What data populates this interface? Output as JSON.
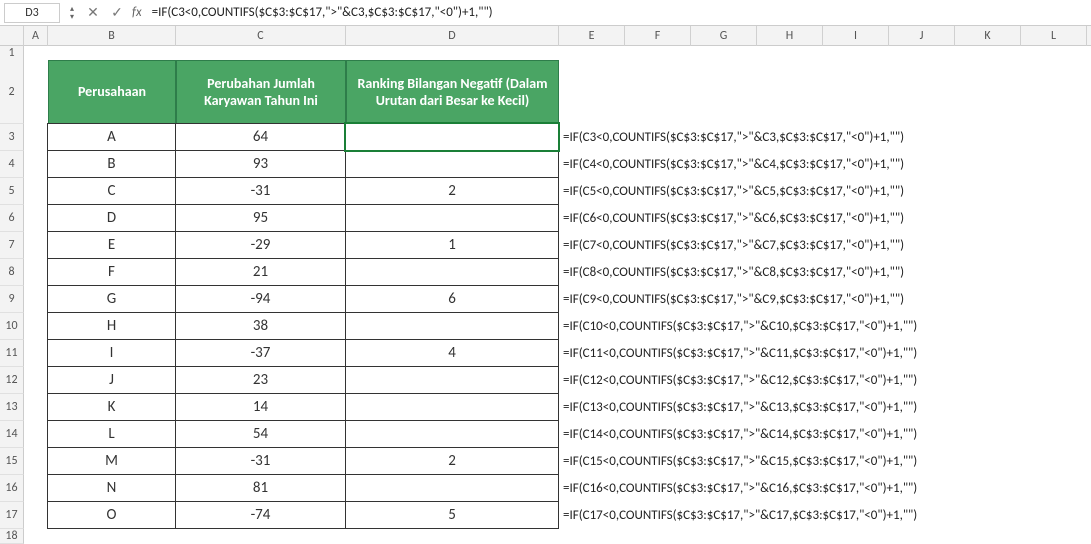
{
  "nameBox": "D3",
  "formulaBar": "=IF(C3<0,COUNTIFS($C$3:$C$17,\">\"&C3,$C$3:$C$17,\"<0\")+1,\"\")",
  "columns": [
    "",
    "A",
    "B",
    "C",
    "D",
    "E",
    "F",
    "G",
    "H",
    "I",
    "J",
    "K",
    "L"
  ],
  "headerLabels": {
    "col1": "Perusahaan",
    "col2": "Perubahan Jumlah Karyawan Tahun Ini",
    "col3": "Ranking Bilangan Negatif (Dalam Urutan dari Besar ke Kecil)"
  },
  "rows": [
    {
      "n": "3",
      "p": "A",
      "v": "64",
      "r": "",
      "f": "=IF(C3<0,COUNTIFS($C$3:$C$17,\">\"&C3,$C$3:$C$17,\"<0\")+1,\"\")"
    },
    {
      "n": "4",
      "p": "B",
      "v": "93",
      "r": "",
      "f": "=IF(C4<0,COUNTIFS($C$3:$C$17,\">\"&C4,$C$3:$C$17,\"<0\")+1,\"\")"
    },
    {
      "n": "5",
      "p": "C",
      "v": "-31",
      "r": "2",
      "f": "=IF(C5<0,COUNTIFS($C$3:$C$17,\">\"&C5,$C$3:$C$17,\"<0\")+1,\"\")"
    },
    {
      "n": "6",
      "p": "D",
      "v": "95",
      "r": "",
      "f": "=IF(C6<0,COUNTIFS($C$3:$C$17,\">\"&C6,$C$3:$C$17,\"<0\")+1,\"\")"
    },
    {
      "n": "7",
      "p": "E",
      "v": "-29",
      "r": "1",
      "f": "=IF(C7<0,COUNTIFS($C$3:$C$17,\">\"&C7,$C$3:$C$17,\"<0\")+1,\"\")"
    },
    {
      "n": "8",
      "p": "F",
      "v": "21",
      "r": "",
      "f": "=IF(C8<0,COUNTIFS($C$3:$C$17,\">\"&C8,$C$3:$C$17,\"<0\")+1,\"\")"
    },
    {
      "n": "9",
      "p": "G",
      "v": "-94",
      "r": "6",
      "f": "=IF(C9<0,COUNTIFS($C$3:$C$17,\">\"&C9,$C$3:$C$17,\"<0\")+1,\"\")"
    },
    {
      "n": "10",
      "p": "H",
      "v": "38",
      "r": "",
      "f": "=IF(C10<0,COUNTIFS($C$3:$C$17,\">\"&C10,$C$3:$C$17,\"<0\")+1,\"\")"
    },
    {
      "n": "11",
      "p": "I",
      "v": "-37",
      "r": "4",
      "f": "=IF(C11<0,COUNTIFS($C$3:$C$17,\">\"&C11,$C$3:$C$17,\"<0\")+1,\"\")"
    },
    {
      "n": "12",
      "p": "J",
      "v": "23",
      "r": "",
      "f": "=IF(C12<0,COUNTIFS($C$3:$C$17,\">\"&C12,$C$3:$C$17,\"<0\")+1,\"\")"
    },
    {
      "n": "13",
      "p": "K",
      "v": "14",
      "r": "",
      "f": "=IF(C13<0,COUNTIFS($C$3:$C$17,\">\"&C13,$C$3:$C$17,\"<0\")+1,\"\")"
    },
    {
      "n": "14",
      "p": "L",
      "v": "54",
      "r": "",
      "f": "=IF(C14<0,COUNTIFS($C$3:$C$17,\">\"&C14,$C$3:$C$17,\"<0\")+1,\"\")"
    },
    {
      "n": "15",
      "p": "M",
      "v": "-31",
      "r": "2",
      "f": "=IF(C15<0,COUNTIFS($C$3:$C$17,\">\"&C15,$C$3:$C$17,\"<0\")+1,\"\")"
    },
    {
      "n": "16",
      "p": "N",
      "v": "81",
      "r": "",
      "f": "=IF(C16<0,COUNTIFS($C$3:$C$17,\">\"&C16,$C$3:$C$17,\"<0\")+1,\"\")"
    },
    {
      "n": "17",
      "p": "O",
      "v": "-74",
      "r": "5",
      "f": "=IF(C17<0,COUNTIFS($C$3:$C$17,\">\"&C17,$C$3:$C$17,\"<0\")+1,\"\")"
    }
  ],
  "selectedRowN": "3",
  "preRows": [
    "1"
  ],
  "headerRowN": "2",
  "postRows": [
    "18"
  ],
  "icons": {
    "up": "▴",
    "down": "▾",
    "cancel": "✕",
    "confirm": "✓"
  }
}
